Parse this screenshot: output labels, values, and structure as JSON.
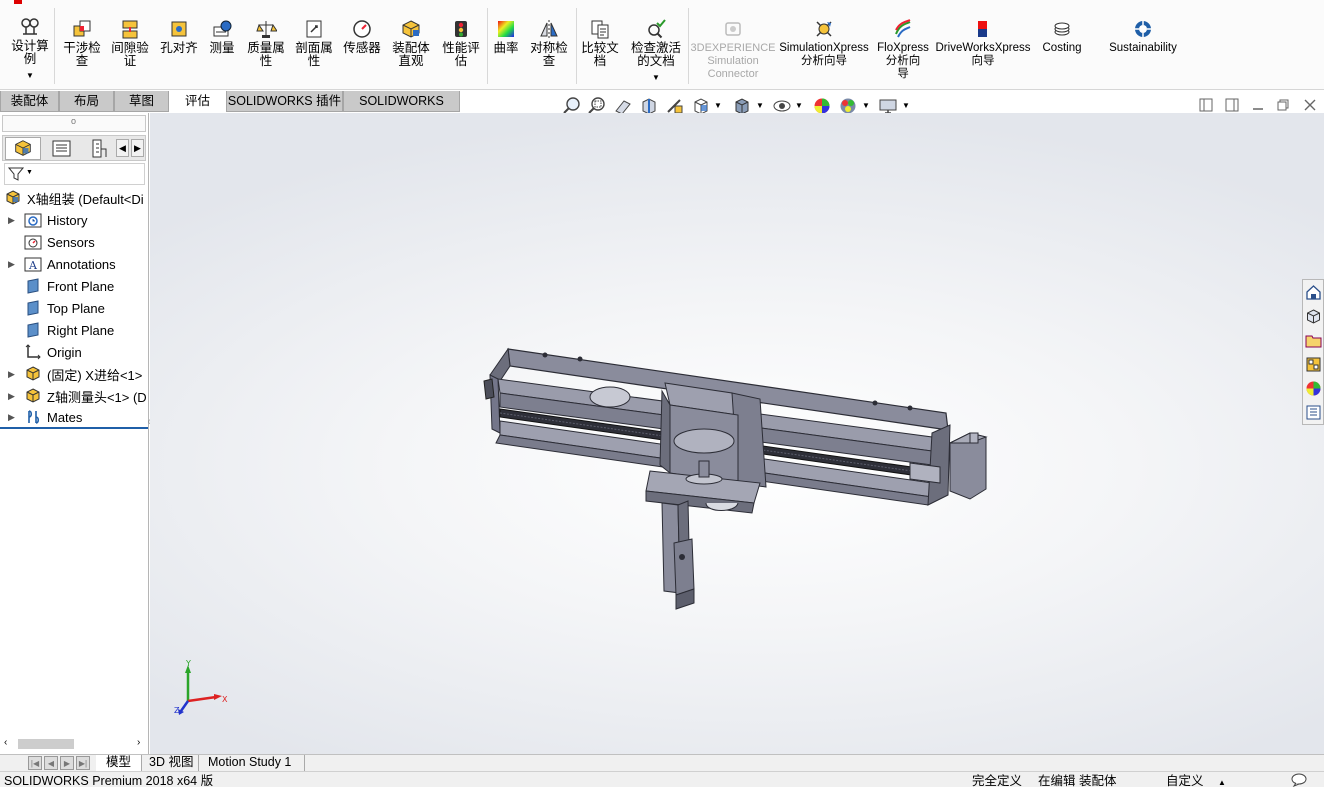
{
  "ribbon": {
    "buttons": [
      {
        "label": "设计算\n例",
        "icon": "design-study-icon"
      },
      {
        "label": "干涉检\n查",
        "icon": "interference-detection-icon"
      },
      {
        "label": "间隙验\n证",
        "icon": "clearance-verification-icon"
      },
      {
        "label": "孔对齐",
        "icon": "hole-alignment-icon"
      },
      {
        "label": "测量",
        "icon": "measure-icon"
      },
      {
        "label": "质量属\n性",
        "icon": "mass-properties-icon"
      },
      {
        "label": "剖面属\n性",
        "icon": "section-properties-icon"
      },
      {
        "label": "传感器",
        "icon": "sensor-icon"
      },
      {
        "label": "装配体\n直观",
        "icon": "assembly-visualization-icon"
      },
      {
        "label": "性能评\n估",
        "icon": "performance-evaluation-icon"
      },
      {
        "label": "曲率",
        "icon": "curvature-icon"
      },
      {
        "label": "对称检\n查",
        "icon": "symmetry-check-icon"
      },
      {
        "label": "比较文\n档",
        "icon": "compare-documents-icon"
      },
      {
        "label": "检查激活\n的文档",
        "icon": "check-active-document-icon"
      },
      {
        "label": "3DEXPERIENCE\nSimulation\nConnector",
        "icon": "3dexperience-icon",
        "disabled": true
      },
      {
        "label": "SimulationXpress\n分析向导",
        "icon": "simulationxpress-icon"
      },
      {
        "label": "FloXpress\n分析向\n导",
        "icon": "floxpress-icon"
      },
      {
        "label": "DriveWorksXpress\n向导",
        "icon": "driveworksxpress-icon"
      },
      {
        "label": "Costing",
        "icon": "costing-icon"
      },
      {
        "label": "Sustainability",
        "icon": "sustainability-icon"
      }
    ]
  },
  "tabs": [
    "装配体",
    "布局",
    "草图",
    "评估",
    "SOLIDWORKS 插件",
    "SOLIDWORKS MBD"
  ],
  "active_tab": "评估",
  "tree": {
    "root": "X轴组装  (Default<Di",
    "items": [
      {
        "label": "History",
        "icon": "history-folder-icon",
        "expandable": true
      },
      {
        "label": "Sensors",
        "icon": "sensors-folder-icon",
        "expandable": false
      },
      {
        "label": "Annotations",
        "icon": "annotations-folder-icon",
        "expandable": true
      },
      {
        "label": "Front Plane",
        "icon": "plane-icon",
        "expandable": false
      },
      {
        "label": "Top Plane",
        "icon": "plane-icon",
        "expandable": false
      },
      {
        "label": "Right Plane",
        "icon": "plane-icon",
        "expandable": false
      },
      {
        "label": "Origin",
        "icon": "origin-icon",
        "expandable": false
      },
      {
        "label": "(固定) X进给<1>",
        "icon": "subassembly-icon",
        "expandable": true
      },
      {
        "label": "Z轴测量头<1> (D",
        "icon": "subassembly-icon",
        "expandable": true
      },
      {
        "label": "Mates",
        "icon": "mates-folder-icon",
        "expandable": true
      }
    ]
  },
  "triad": {
    "x": "X",
    "y": "Y",
    "z": "Z"
  },
  "bottom_tabs": [
    "模型",
    "3D 视图",
    "Motion Study 1"
  ],
  "status": {
    "product": "SOLIDWORKS Premium 2018 x64 版",
    "definition": "完全定义",
    "editing": "在编辑 装配体",
    "units": "自定义"
  },
  "colors": {
    "accent_blue": "#1f5fa8",
    "model_gray": "#8a8c9c",
    "tab_gray": "#c9c9c9"
  }
}
